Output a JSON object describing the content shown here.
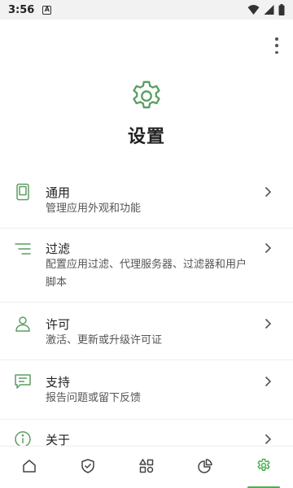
{
  "status_bar": {
    "time": "3:56",
    "notification_glyph": "A",
    "icons": [
      "wifi-icon",
      "signal-icon",
      "battery-icon"
    ]
  },
  "header": {
    "icon": "gear-icon",
    "title": "设置"
  },
  "settings": {
    "items": [
      {
        "icon": "phone-icon",
        "title": "通用",
        "desc": "管理应用外观和功能"
      },
      {
        "icon": "filter-lines-icon",
        "title": "过滤",
        "desc": "配置应用过滤、代理服务器、过滤器和用户脚本"
      },
      {
        "icon": "person-icon",
        "title": "许可",
        "desc": "激活、更新或升级许可证"
      },
      {
        "icon": "chat-icon",
        "title": "支持",
        "desc": "报告问题或留下反馈"
      },
      {
        "icon": "info-icon",
        "title": "关于",
        "desc": ""
      }
    ]
  },
  "bottom_nav": {
    "items": [
      "home-icon",
      "shield-check-icon",
      "apps-grid-icon",
      "pie-chart-icon",
      "gear-icon"
    ],
    "active": "gear-icon"
  },
  "colors": {
    "accent": "#4caf50",
    "icon_green": "#5a9e62",
    "text_primary": "#222222",
    "text_secondary": "#555555"
  }
}
